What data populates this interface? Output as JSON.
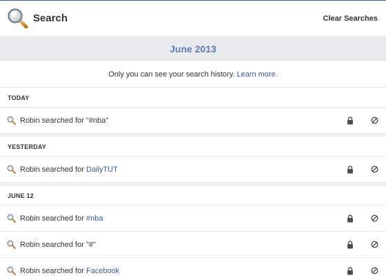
{
  "header": {
    "title": "Search",
    "clear_label": "Clear Searches"
  },
  "month": "June 2013",
  "privacy": {
    "text": "Only you can see your search history.",
    "link": "Learn more."
  },
  "sections": [
    {
      "label": "TODAY",
      "entries": [
        {
          "prefix": "Robin searched for ",
          "query": "\"#nba\"",
          "is_link": false
        }
      ]
    },
    {
      "label": "YESTERDAY",
      "entries": [
        {
          "prefix": "Robin searched for ",
          "query": "DailyTUT",
          "is_link": true
        }
      ]
    },
    {
      "label": "JUNE 12",
      "entries": [
        {
          "prefix": "Robin searched for ",
          "query": "#nba",
          "is_link": true
        },
        {
          "prefix": "Robin searched for ",
          "query": "\"#\"",
          "is_link": false
        },
        {
          "prefix": "Robin searched for ",
          "query": "Facebook",
          "is_link": true
        }
      ]
    }
  ],
  "icons": {
    "title": "magnifier-icon",
    "entry": "magnifier-icon",
    "privacy": "lock-icon",
    "remove": "remove-icon"
  },
  "colors": {
    "link": "#3b5998",
    "month": "#627aad",
    "band": "#e9eaed"
  }
}
